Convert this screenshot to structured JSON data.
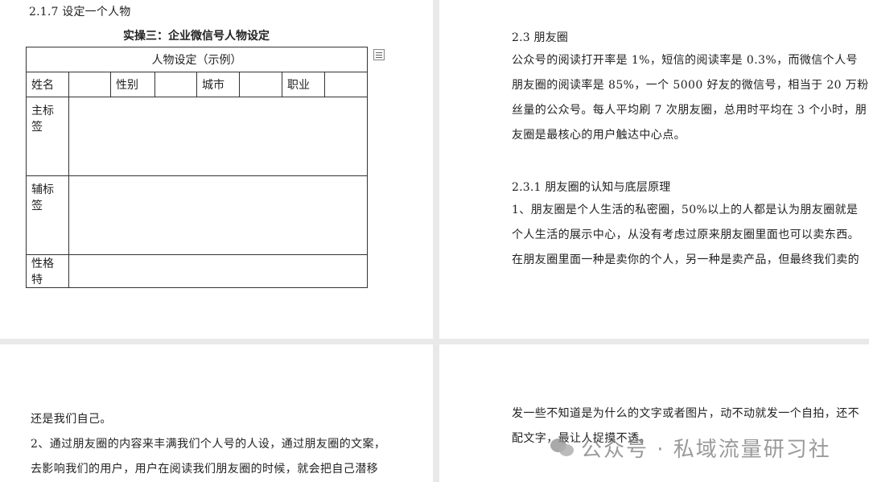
{
  "page1": {
    "section_heading": "2.1.7 设定一个人物",
    "exercise_title": "实操三：企业微信号人物设定",
    "table": {
      "title": "人物设定（示例）",
      "fields": [
        "姓名",
        "性别",
        "城市",
        "职业"
      ],
      "rows": [
        "主标签",
        "辅标签",
        "性格特"
      ]
    }
  },
  "page2": {
    "section_heading": "2.3 朋友圈",
    "paragraph_lines": [
      "公众号的阅读打开率是 1%，短信的阅读率是 0.3%，而微信个人号",
      "朋友圈的阅读率是 85%，一个 5000 好友的微信号，相当于 20 万粉",
      "丝量的公众号。每人平均刷 7 次朋友圈，总用时平均在 3 个小时，朋",
      "友圈是最核心的用户触达中心点。"
    ],
    "subsection_heading": "2.3.1 朋友圈的认知与底层原理",
    "subsection_lines": [
      "1、朋友圈是个人生活的私密圈，50%以上的人都是认为朋友圈就是",
      "个人生活的展示中心，从没有考虑过原来朋友圈里面也可以卖东西。",
      "在朋友圈里面一种是卖你的个人，另一种是卖产品，但最终我们卖的"
    ]
  },
  "page3": {
    "lines": [
      "还是我们自己。",
      "2、通过朋友圈的内容来丰满我们个人号的人设，通过朋友圈的文案，",
      "去影响我们的用户，用户在阅读我们朋友圈的时候，就会把自己潜移"
    ]
  },
  "page4": {
    "lines": [
      "发一些不知道是为什么的文字或者图片，动不动就发一个自拍，还不",
      "配文字，最让人捉摸不透。"
    ]
  },
  "watermark": {
    "text": "公众号 · 私域流量研习社",
    "logo_icon": "wechat-logo-icon"
  }
}
